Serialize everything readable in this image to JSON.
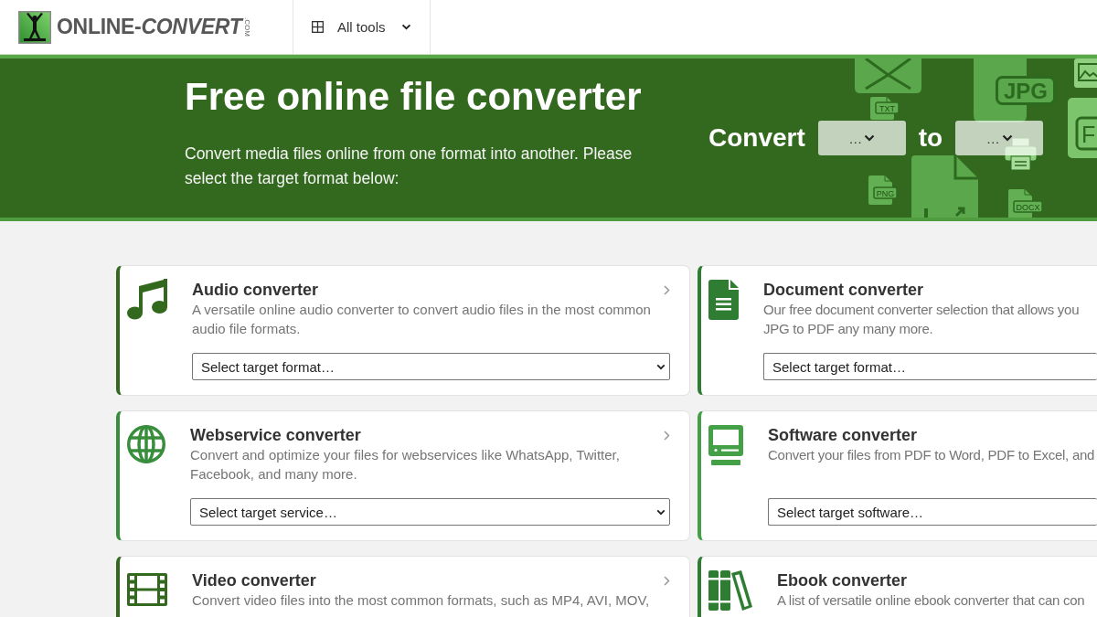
{
  "header": {
    "logo": {
      "wordmark": "ONLINE-*CONVERT*",
      "domain": ".COM"
    },
    "menu_button": {
      "label": "All tools"
    }
  },
  "hero": {
    "title": "Free online file converter",
    "subtitle": "Convert media files online from one format into another. Please select the target format below:",
    "convert_label": "Convert",
    "from_select": {
      "value": "…"
    },
    "to_label": "to",
    "to_select": {
      "value": "…"
    },
    "background_files": [
      {
        "label": "JPG"
      },
      {
        "label": "F"
      },
      {
        "label": "TXT"
      },
      {
        "label": "PNG"
      },
      {
        "label": "DOCX"
      }
    ]
  },
  "converters": [
    {
      "kind": "audio",
      "title": "Audio converter",
      "description": "A versatile online audio converter to convert audio files in the most common\naudio file formats.",
      "select": {
        "value": "Select target format…"
      },
      "color": "#33691e"
    },
    {
      "kind": "document",
      "title": "Document converter",
      "description": "Our free document converter selection that allows you\nJPG to PDF any many more.",
      "select": {
        "value": "Select target format…"
      },
      "color": "#2e7d32"
    },
    {
      "kind": "webservice",
      "title": "Webservice converter",
      "description": "Convert and optimize your files for webservices like WhatsApp, Twitter,\nFacebook, and many more.",
      "select": {
        "value": "Select target service…"
      },
      "color": "#388e3c"
    },
    {
      "kind": "software",
      "title": "Software converter",
      "description": "Convert your files from PDF to Word, PDF to Excel, and",
      "select": {
        "value": "Select target software…"
      },
      "color": "#43a047"
    },
    {
      "kind": "video",
      "title": "Video converter",
      "description": "Convert video files into the most common formats, such as MP4, AVI, MOV,",
      "color": "#33691e"
    },
    {
      "kind": "ebook",
      "title": "Ebook converter",
      "description": "A list of versatile online ebook converter that can con",
      "color": "#2e7d32"
    }
  ]
}
